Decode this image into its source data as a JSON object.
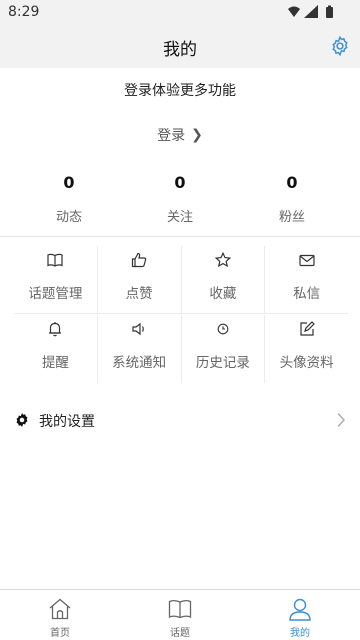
{
  "status_bar": {
    "time": "8:29"
  },
  "app_bar": {
    "title": "我的"
  },
  "login": {
    "hint": "登录体验更多功能",
    "link_label": "登录",
    "link_arrow": "❯"
  },
  "stats": [
    {
      "value": "0",
      "label": "动态"
    },
    {
      "value": "0",
      "label": "关注"
    },
    {
      "value": "0",
      "label": "粉丝"
    }
  ],
  "grid": [
    {
      "label": "话题管理",
      "icon": "book-icon"
    },
    {
      "label": "点赞",
      "icon": "thumbs-up-icon"
    },
    {
      "label": "收藏",
      "icon": "star-icon"
    },
    {
      "label": "私信",
      "icon": "mail-icon"
    },
    {
      "label": "提醒",
      "icon": "bell-icon"
    },
    {
      "label": "系统通知",
      "icon": "speaker-icon"
    },
    {
      "label": "历史记录",
      "icon": "clock-icon"
    },
    {
      "label": "头像资料",
      "icon": "edit-icon"
    }
  ],
  "settings": {
    "label": "我的设置"
  },
  "bottom_nav": [
    {
      "label": "首页",
      "icon": "home-icon",
      "active": false
    },
    {
      "label": "话题",
      "icon": "book-icon",
      "active": false
    },
    {
      "label": "我的",
      "icon": "user-icon",
      "active": true
    }
  ],
  "colors": {
    "accent": "#3a8fd6",
    "background": "#f2f2f2",
    "text_muted": "#666666"
  }
}
